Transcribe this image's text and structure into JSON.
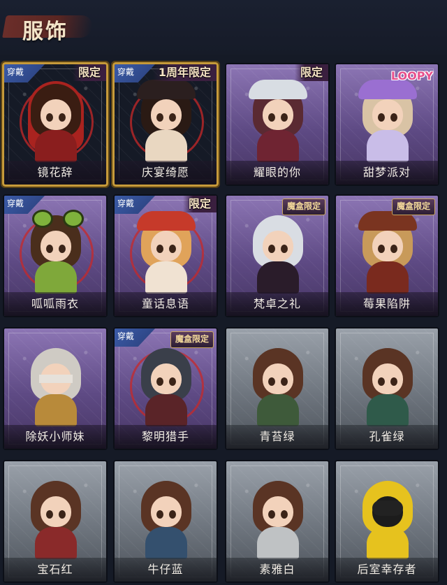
{
  "header": {
    "title": "服饰"
  },
  "colors": {
    "gold_frame": "#c69a3a",
    "purple_card": "#6e5a96",
    "gray_card": "#7a8088",
    "wear_tag": "#3b5ba8"
  },
  "items": [
    {
      "name": "镜花辞",
      "wear": "穿戴",
      "badge": "限定",
      "badge_type": "limited",
      "rarity": "gold",
      "art": "red-hood-girl"
    },
    {
      "name": "庆宴绮愿",
      "wear": "穿戴",
      "badge": "1周年限定",
      "badge_type": "limited",
      "rarity": "gold",
      "art": "cake-girl"
    },
    {
      "name": "耀眼的你",
      "wear": "",
      "badge": "限定",
      "badge_type": "limited",
      "rarity": "purple",
      "art": "cowboy-hat-girl"
    },
    {
      "name": "甜梦派对",
      "wear": "",
      "badge": "LOOPY",
      "badge_type": "logo",
      "rarity": "purple",
      "art": "party-girl"
    },
    {
      "name": "呱呱雨衣",
      "wear": "穿戴",
      "badge": "",
      "badge_type": "",
      "rarity": "purple",
      "art": "frog-girl"
    },
    {
      "name": "童话息语",
      "wear": "穿戴",
      "badge": "限定",
      "badge_type": "limited",
      "rarity": "purple",
      "art": "fairy-girl"
    },
    {
      "name": "梵卓之礼",
      "wear": "",
      "badge": "魔盒限定",
      "badge_type": "box",
      "rarity": "purple",
      "art": "vampire-boy"
    },
    {
      "name": "莓果陷阱",
      "wear": "",
      "badge": "魔盒限定",
      "badge_type": "box",
      "rarity": "purple",
      "art": "berry-girl"
    },
    {
      "name": "除妖小师妹",
      "wear": "",
      "badge": "",
      "badge_type": "",
      "rarity": "purple",
      "art": "blindfold-girl"
    },
    {
      "name": "黎明猎手",
      "wear": "穿戴",
      "badge": "魔盒限定",
      "badge_type": "box",
      "rarity": "purple",
      "art": "hunter-boy"
    },
    {
      "name": "青苔绿",
      "wear": "",
      "badge": "",
      "badge_type": "",
      "rarity": "gray",
      "art": "base-green"
    },
    {
      "name": "孔雀绿",
      "wear": "",
      "badge": "",
      "badge_type": "",
      "rarity": "gray",
      "art": "base-teal"
    },
    {
      "name": "宝石红",
      "wear": "",
      "badge": "",
      "badge_type": "",
      "rarity": "gray",
      "art": "base-red"
    },
    {
      "name": "牛仔蓝",
      "wear": "",
      "badge": "",
      "badge_type": "",
      "rarity": "gray",
      "art": "base-blue"
    },
    {
      "name": "素雅白",
      "wear": "",
      "badge": "",
      "badge_type": "",
      "rarity": "gray",
      "art": "base-white"
    },
    {
      "name": "后室幸存者",
      "wear": "",
      "badge": "",
      "badge_type": "",
      "rarity": "gray",
      "art": "yellow-hazmat"
    }
  ]
}
